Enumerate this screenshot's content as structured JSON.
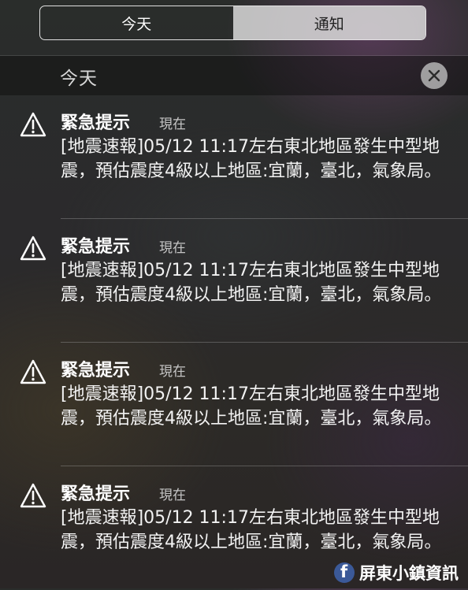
{
  "segmented_control": {
    "today_label": "今天",
    "notifications_label": "通知",
    "selected": "today"
  },
  "section": {
    "title": "今天",
    "clear_icon": "close-icon"
  },
  "notifications": [
    {
      "icon": "warning-icon",
      "title": "緊急提示",
      "time": "現在",
      "body": "[地震速報]05/12 11:17左右東北地區發生中型地震，預估震度4級以上地區:宜蘭，臺北，氣象局。"
    },
    {
      "icon": "warning-icon",
      "title": "緊急提示",
      "time": "現在",
      "body": "[地震速報]05/12 11:17左右東北地區發生中型地震，預估震度4級以上地區:宜蘭，臺北，氣象局。"
    },
    {
      "icon": "warning-icon",
      "title": "緊急提示",
      "time": "現在",
      "body": "[地震速報]05/12 11:17左右東北地區發生中型地震，預估震度4級以上地區:宜蘭，臺北，氣象局。"
    },
    {
      "icon": "warning-icon",
      "title": "緊急提示",
      "time": "現在",
      "body": "[地震速報]05/12 11:17左右東北地區發生中型地震，預估震度4級以上地區:宜蘭，臺北，氣象局。"
    }
  ],
  "watermark": {
    "logo": "facebook-icon",
    "text": "屏東小鎮資訊"
  },
  "colors": {
    "segment_inactive_bg": "#e1e1e1",
    "facebook_blue": "#3b5998"
  }
}
